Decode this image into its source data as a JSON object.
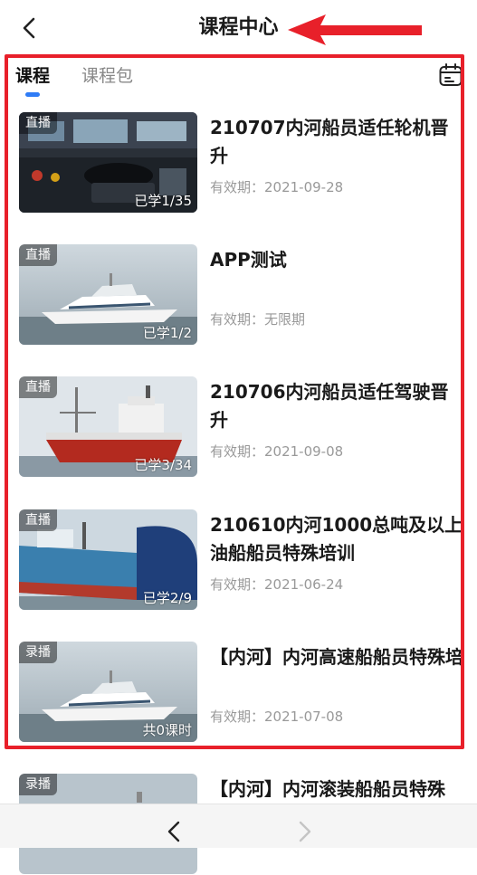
{
  "header": {
    "title": "课程中心"
  },
  "tabs": [
    {
      "label": "课程",
      "active": true
    },
    {
      "label": "课程包",
      "active": false
    }
  ],
  "icons": {
    "back": "back-arrow-icon",
    "calendar": "calendar-icon",
    "annotation": "red-arrow-annotation-icon",
    "nav_back": "browser-back-icon",
    "nav_forward": "browser-forward-icon"
  },
  "colors": {
    "accent": "#2f7cf6",
    "annotation": "#e8202a",
    "muted_text": "#999999"
  },
  "courses": [
    {
      "tag": "直播",
      "progress": "已学1/35",
      "title": "210707内河船员适任轮机晋升",
      "validity": "有效期：2021-09-28",
      "image": "ship-control-panel"
    },
    {
      "tag": "直播",
      "progress": "已学1/2",
      "title": "APP测试",
      "validity": "有效期：无限期",
      "image": "white-passenger-boat"
    },
    {
      "tag": "直播",
      "progress": "已学3/34",
      "title": "210706内河船员适任驾驶晋升",
      "validity": "有效期：2021-09-08",
      "image": "red-tanker"
    },
    {
      "tag": "直播",
      "progress": "已学2/9",
      "title": "210610内河1000总吨及以上油船船员特殊培训",
      "validity": "有效期：2021-06-24",
      "image": "blue-cargo-ship"
    },
    {
      "tag": "录播",
      "progress": "共0课时",
      "title": "【内河】内河高速船船员特殊培",
      "validity": "有效期：2021-07-08",
      "image": "white-passenger-boat"
    },
    {
      "tag": "录播",
      "progress": "",
      "title": "【内河】内河滚装船船员特殊",
      "validity": "",
      "image": "white-passenger-boat"
    }
  ]
}
